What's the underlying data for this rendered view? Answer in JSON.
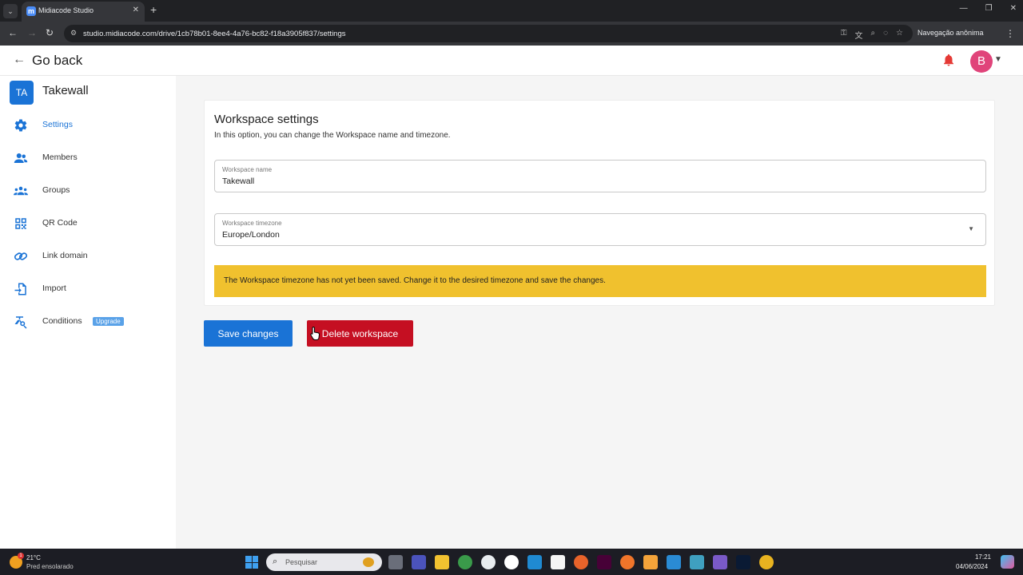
{
  "browser": {
    "tab_title": "Midiacode Studio",
    "tab_favicon": "m",
    "url": "studio.midiacode.com/drive/1cb78b01-8ee4-4a76-bc82-f18a3905f837/settings",
    "incognito_label": "Navegação anônima"
  },
  "header": {
    "back_label": "Go back",
    "avatar_initial": "B"
  },
  "sidebar": {
    "workspace_initials": "TA",
    "workspace_name": "Takewall",
    "items": [
      {
        "label": "Settings",
        "icon": "gear-icon",
        "active": true
      },
      {
        "label": "Members",
        "icon": "members-icon"
      },
      {
        "label": "Groups",
        "icon": "groups-icon"
      },
      {
        "label": "QR Code",
        "icon": "qr-code-icon"
      },
      {
        "label": "Link domain",
        "icon": "link-icon"
      },
      {
        "label": "Import",
        "icon": "import-icon"
      },
      {
        "label": "Conditions",
        "icon": "conditions-icon",
        "badge": "Upgrade"
      }
    ]
  },
  "settings": {
    "title": "Workspace settings",
    "subtitle": "In this option, you can change the Workspace name and timezone.",
    "name_label": "Workspace name",
    "name_value": "Takewall",
    "timezone_label": "Workspace timezone",
    "timezone_value": "Europe/London",
    "warning": "The Workspace timezone has not yet been saved. Change it to the desired timezone and save the changes."
  },
  "actions": {
    "save_label": "Save changes",
    "delete_label": "Delete workspace"
  },
  "taskbar": {
    "temperature": "21°C",
    "weather": "Pred ensolarado",
    "weather_alert": "1",
    "search_placeholder": "Pesquisar",
    "time": "17:21",
    "date": "04/06/2024"
  },
  "colors": {
    "primary": "#1a73d6",
    "danger": "#c50f22",
    "warning": "#f0c12e",
    "bell": "#e53935",
    "avatar": "#e0447a"
  }
}
